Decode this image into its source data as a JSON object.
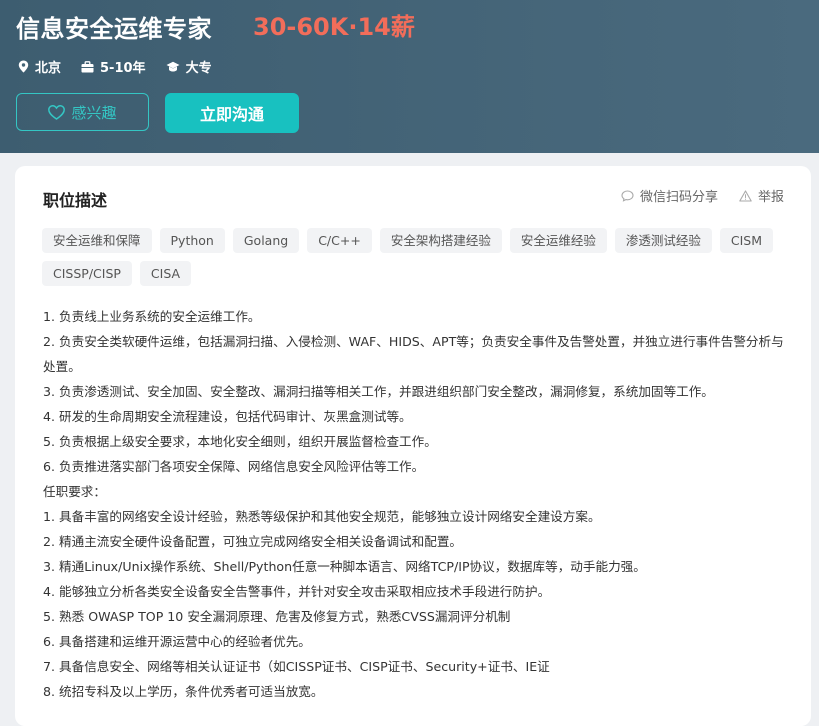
{
  "job": {
    "title": "信息安全运维专家",
    "salary": "30-60K·14薪",
    "location": "北京",
    "experience": "5-10年",
    "education": "大专"
  },
  "actions": {
    "like_label": "感兴趣",
    "chat_label": "立即沟通"
  },
  "section": {
    "title": "职位描述",
    "share_label": "微信扫码分享",
    "report_label": "举报"
  },
  "tags": [
    "安全运维和保障",
    "Python",
    "Golang",
    "C/C++",
    "安全架构搭建经验",
    "安全运维经验",
    "渗透测试经验",
    "CISM",
    "CISSP/CISP",
    "CISA"
  ],
  "description": [
    "1. 负责线上业务系统的安全运维工作。",
    "2. 负责安全类软硬件运维，包括漏洞扫描、入侵检测、WAF、HIDS、APT等；负责安全事件及告警处置，并独立进行事件告警分析与处置。",
    "3. 负责渗透测试、安全加固、安全整改、漏洞扫描等相关工作，并跟进组织部门安全整改，漏洞修复，系统加固等工作。",
    "4. 研发的生命周期安全流程建设，包括代码审计、灰黑盒测试等。",
    "5. 负责根据上级安全要求，本地化安全细则，组织开展监督检查工作。",
    "6. 负责推进落实部门各项安全保障、网络信息安全风险评估等工作。",
    "任职要求：",
    "1. 具备丰富的网络安全设计经验，熟悉等级保护和其他安全规范，能够独立设计网络安全建设方案。",
    "2. 精通主流安全硬件设备配置，可独立完成网络安全相关设备调试和配置。",
    "3. 精通Linux/Unix操作系统、Shell/Python任意一种脚本语言、网络TCP/IP协议，数据库等，动手能力强。",
    "4. 能够独立分析各类安全设备安全告警事件，并针对安全攻击采取相应技术手段进行防护。",
    "5. 熟悉 OWASP TOP 10 安全漏洞原理、危害及修复方式，熟悉CVSS漏洞评分机制",
    "6. 具备搭建和运维开源运营中心的经验者优先。",
    "7. 具备信息安全、网络等相关认证证书（如CISSP证书、CISP证书、Security+证书、IE证",
    "8. 统招专科及以上学历，条件优秀者可适当放宽。"
  ],
  "colors": {
    "header_bg": "#3d5d70",
    "salary": "#f26d5a",
    "accent": "#18c1c0"
  },
  "icons": [
    "location-pin-icon",
    "briefcase-icon",
    "graduation-cap-icon",
    "heart-icon",
    "wechat-chat-icon",
    "warning-icon"
  ]
}
